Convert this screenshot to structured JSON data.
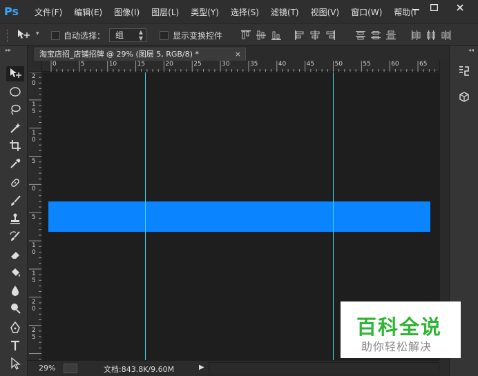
{
  "app": {
    "logo": "Ps",
    "accent_color": "#31a8ff"
  },
  "menu": {
    "items": [
      "文件(F)",
      "编辑(E)",
      "图像(I)",
      "图层(L)",
      "类型(Y)",
      "选择(S)",
      "滤镜(T)",
      "视图(V)",
      "窗口(W)",
      "帮助(I"
    ]
  },
  "window_controls": {
    "minimize_icon": "minimize-icon",
    "maximize_icon": "maximize-icon",
    "close_icon": "close-icon"
  },
  "options_bar": {
    "auto_select_label": "自动选择：",
    "auto_select_checked": false,
    "auto_select_target": "组",
    "show_transform_label": "显示变换控件",
    "show_transform_checked": false
  },
  "document": {
    "tab_title": "淘宝店招_店铺招牌 @ 29% (图层 5, RGB/8) *",
    "close_label": "×",
    "layer_color": "#0a84ff",
    "guide_color": "#43d6e6"
  },
  "ruler": {
    "h_labels": [
      "0",
      "5",
      "10",
      "15",
      "20",
      "25",
      "30",
      "35",
      "40",
      "45",
      "50",
      "55",
      "60",
      "65"
    ],
    "v_labels": [
      "2\n0",
      "1\n5",
      "1\n0",
      "5",
      "0",
      "5",
      "1\n0",
      "1\n5",
      "2\n0",
      "2\n5"
    ]
  },
  "status": {
    "zoom": "29%",
    "doc_info": "文档:843.8K/9.60M"
  },
  "watermark": {
    "main": "百科全说",
    "sub": "助你轻松解决",
    "color": "#2fb534"
  }
}
